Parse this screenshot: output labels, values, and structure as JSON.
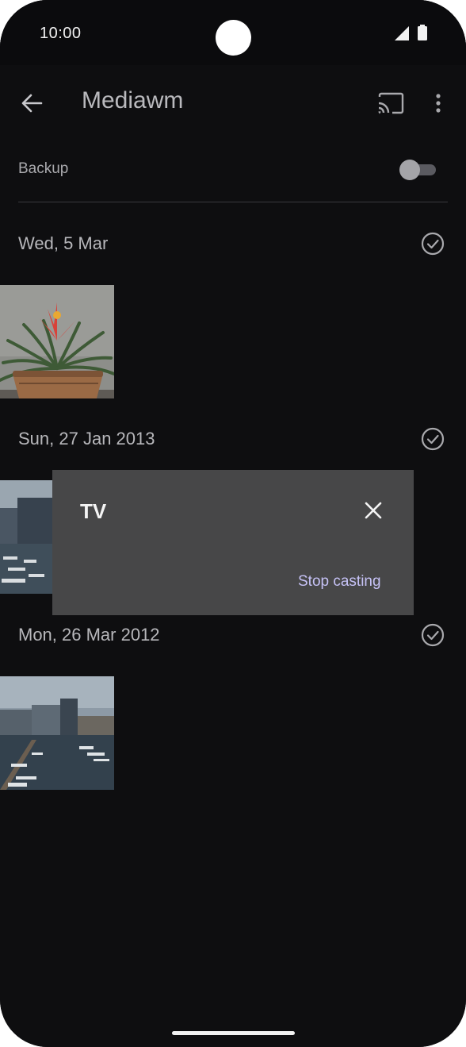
{
  "status_bar": {
    "time": "10:00"
  },
  "app_bar": {
    "title": "Mediawm"
  },
  "backup": {
    "label": "Backup",
    "enabled": false
  },
  "sections": [
    {
      "date": "Wed, 5 Mar"
    },
    {
      "date": "Sun, 27 Jan 2013"
    },
    {
      "date": "Mon, 26 Mar 2012"
    }
  ],
  "cast_dialog": {
    "title": "TV",
    "action_label": "Stop casting"
  },
  "colors": {
    "background": "#0f0f11",
    "dialog": "#474748",
    "accent_text": "#c6c2f6"
  },
  "icons": [
    "back-arrow-icon",
    "cast-icon",
    "more-vert-icon",
    "check-circle-icon",
    "close-icon",
    "signal-icon",
    "battery-icon"
  ]
}
